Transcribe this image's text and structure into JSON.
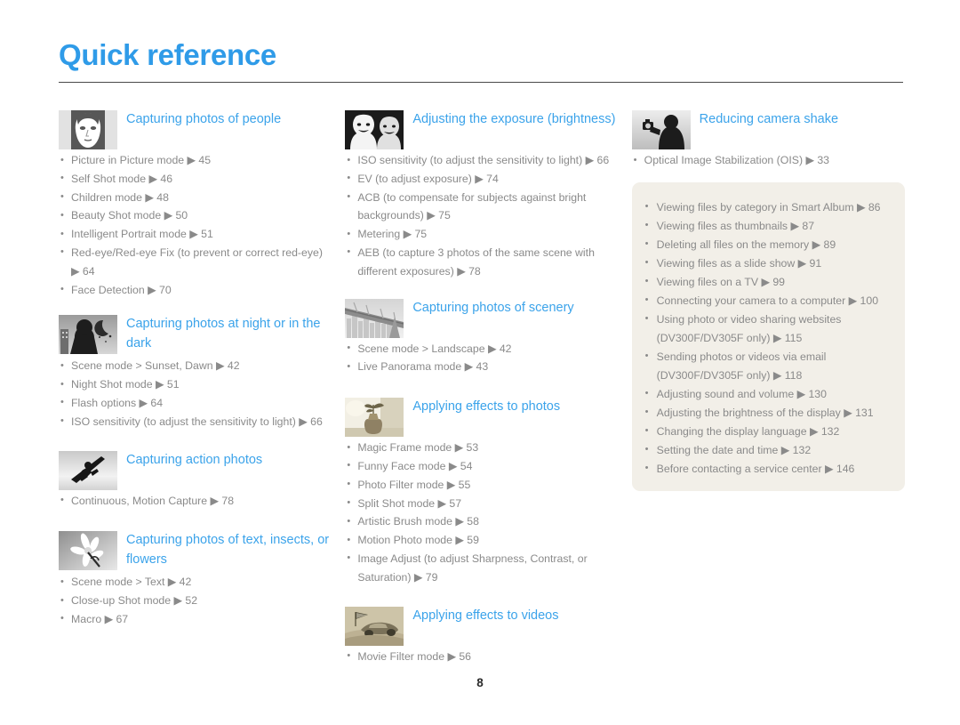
{
  "document": {
    "title": "Quick reference",
    "page_number": "8",
    "accent_color": "#3ba3ea",
    "title_color": "#2f9be8",
    "infobox_color": "#f2efe8"
  },
  "columns": [
    {
      "sections": [
        {
          "icon": "portrait-face-thumbnail",
          "title": "Capturing photos of people",
          "items": [
            "Picture in Picture mode ▶ 45",
            "Self Shot mode ▶ 46",
            "Children mode ▶ 48",
            "Beauty Shot mode ▶ 50",
            "Intelligent Portrait mode ▶ 51",
            "Red-eye/Red-eye Fix (to prevent or correct red-eye) ▶ 64",
            "Face Detection ▶ 70"
          ]
        },
        {
          "icon": "night-silhouette-thumbnail",
          "title": "Capturing photos at night or in the dark",
          "items": [
            "Scene mode > Sunset, Dawn ▶ 42",
            "Night Shot mode ▶ 51",
            "Flash options ▶ 64",
            "ISO sensitivity (to adjust the sensitivity to light) ▶ 66"
          ]
        },
        {
          "icon": "snowboarder-action-thumbnail",
          "title": "Capturing action photos",
          "items": [
            "Continuous, Motion Capture ▶ 78"
          ]
        },
        {
          "icon": "flower-macro-thumbnail",
          "title": "Capturing photos of text, insects, or flowers",
          "items": [
            "Scene mode > Text ▶ 42",
            "Close-up Shot mode ▶ 52",
            "Macro ▶ 67"
          ]
        }
      ]
    },
    {
      "sections": [
        {
          "icon": "two-faces-exposure-thumbnail",
          "title": "Adjusting the exposure (brightness)",
          "items": [
            "ISO sensitivity (to adjust the sensitivity to light) ▶ 66",
            "EV (to adjust exposure) ▶ 74",
            "ACB (to compensate for subjects against bright backgrounds) ▶ 75",
            "Metering ▶ 75",
            "AEB (to capture 3 photos of the same scene with different exposures) ▶ 78"
          ]
        },
        {
          "icon": "bridge-cityscape-thumbnail",
          "title": "Capturing photos of scenery",
          "items": [
            "Scene mode > Landscape ▶ 42",
            "Live Panorama mode ▶ 43"
          ]
        },
        {
          "icon": "vase-still-life-thumbnail",
          "title": "Applying effects to photos",
          "items": [
            "Magic Frame mode ▶ 53",
            "Funny Face mode ▶ 54",
            "Photo Filter mode ▶ 55",
            "Split Shot mode ▶ 57",
            "Artistic Brush mode ▶ 58",
            "Motion Photo mode ▶ 59",
            "Image Adjust (to adjust Sharpness, Contrast, or Saturation) ▶ 79"
          ]
        },
        {
          "icon": "race-car-video-thumbnail",
          "title": "Applying effects to videos",
          "items": [
            "Movie Filter mode ▶ 56"
          ]
        }
      ]
    },
    {
      "sections": [
        {
          "icon": "camera-shake-person-thumbnail",
          "title": "Reducing camera shake",
          "items": [
            "Optical Image Stabilization (OIS) ▶ 33"
          ]
        }
      ],
      "infobox": {
        "items": [
          "Viewing files by category in Smart Album ▶ 86",
          "Viewing files as thumbnails ▶ 87",
          "Deleting all files on the memory ▶ 89",
          "Viewing files as a slide show ▶ 91",
          "Viewing files on a TV ▶ 99",
          "Connecting your camera to a computer ▶ 100",
          "Using photo or video sharing websites (DV300F/DV305F only) ▶ 115",
          "Sending photos or videos via email (DV300F/DV305F only) ▶ 118",
          "Adjusting sound and volume ▶ 130",
          "Adjusting the brightness of the display ▶ 131",
          "Changing the display language ▶ 132",
          "Setting the date and time ▶ 132",
          "Before contacting a service center ▶ 146"
        ]
      }
    }
  ]
}
